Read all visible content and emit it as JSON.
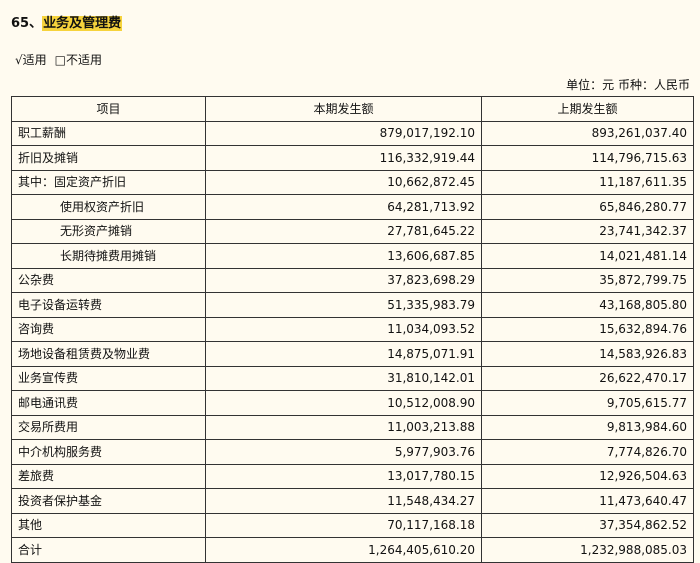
{
  "section": {
    "number": "65、",
    "title": "业务及管理费"
  },
  "applicability": {
    "applicable": "√适用",
    "not_applicable": "□不适用"
  },
  "unit_line": "单位：元  币种：人民币",
  "table": {
    "headers": [
      "项目",
      "本期发生额",
      "上期发生额"
    ],
    "rows": [
      {
        "item": "职工薪酬",
        "current": "879,017,192.10",
        "prior": "893,261,037.40",
        "indent": false
      },
      {
        "item": "折旧及摊销",
        "current": "116,332,919.44",
        "prior": "114,796,715.63",
        "indent": false
      },
      {
        "item": "其中：固定资产折旧",
        "current": "10,662,872.45",
        "prior": "11,187,611.35",
        "indent": false
      },
      {
        "item": "使用权资产折旧",
        "current": "64,281,713.92",
        "prior": "65,846,280.77",
        "indent": true
      },
      {
        "item": "无形资产摊销",
        "current": "27,781,645.22",
        "prior": "23,741,342.37",
        "indent": true
      },
      {
        "item": "长期待摊费用摊销",
        "current": "13,606,687.85",
        "prior": "14,021,481.14",
        "indent": true
      },
      {
        "item": "公杂费",
        "current": "37,823,698.29",
        "prior": "35,872,799.75",
        "indent": false
      },
      {
        "item": "电子设备运转费",
        "current": "51,335,983.79",
        "prior": "43,168,805.80",
        "indent": false
      },
      {
        "item": "咨询费",
        "current": "11,034,093.52",
        "prior": "15,632,894.76",
        "indent": false
      },
      {
        "item": "场地设备租赁费及物业费",
        "current": "14,875,071.91",
        "prior": "14,583,926.83",
        "indent": false
      },
      {
        "item": "业务宣传费",
        "current": "31,810,142.01",
        "prior": "26,622,470.17",
        "indent": false
      },
      {
        "item": "邮电通讯费",
        "current": "10,512,008.90",
        "prior": "9,705,615.77",
        "indent": false
      },
      {
        "item": "交易所费用",
        "current": "11,003,213.88",
        "prior": "9,813,984.60",
        "indent": false
      },
      {
        "item": "中介机构服务费",
        "current": "5,977,903.76",
        "prior": "7,774,826.70",
        "indent": false
      },
      {
        "item": "差旅费",
        "current": "13,017,780.15",
        "prior": "12,926,504.63",
        "indent": false
      },
      {
        "item": "投资者保护基金",
        "current": "11,548,434.27",
        "prior": "11,473,640.47",
        "indent": false
      },
      {
        "item": "其他",
        "current": "70,117,168.18",
        "prior": "37,354,862.52",
        "indent": false
      },
      {
        "item": "合计",
        "current": "1,264,405,610.20",
        "prior": "1,232,988,085.03",
        "indent": false
      }
    ]
  }
}
